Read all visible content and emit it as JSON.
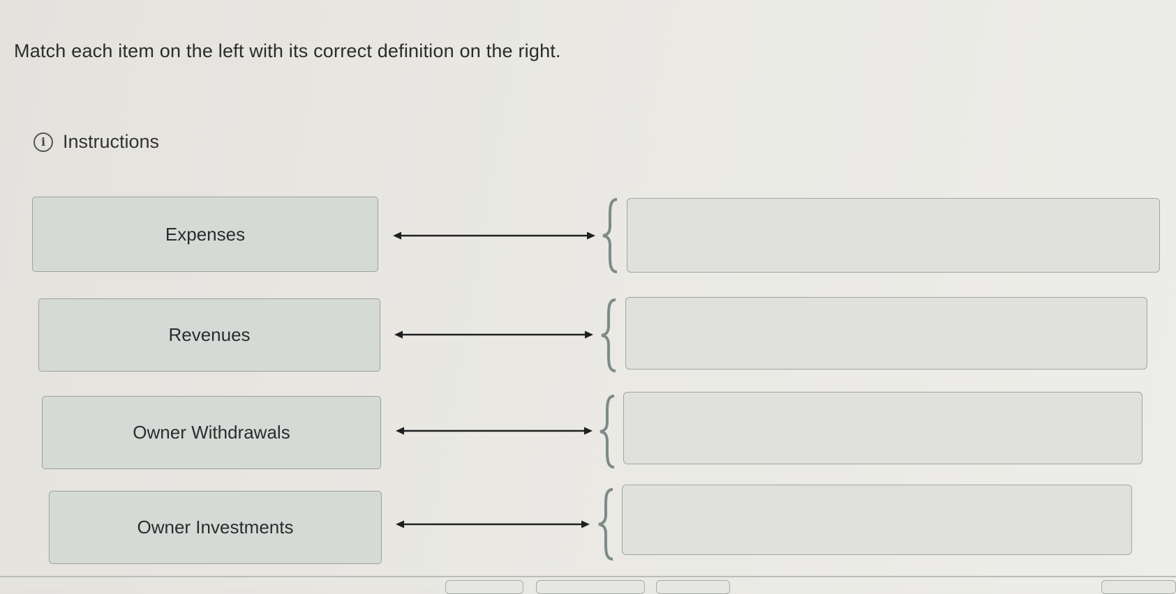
{
  "prompt": "Match each item on the left with its correct definition on the right.",
  "instructions": {
    "label": "Instructions",
    "icon": "info-icon"
  },
  "items": [
    {
      "label": "Expenses",
      "definition": ""
    },
    {
      "label": "Revenues",
      "definition": ""
    },
    {
      "label": "Owner Withdrawals",
      "definition": ""
    },
    {
      "label": "Owner Investments",
      "definition": ""
    }
  ]
}
